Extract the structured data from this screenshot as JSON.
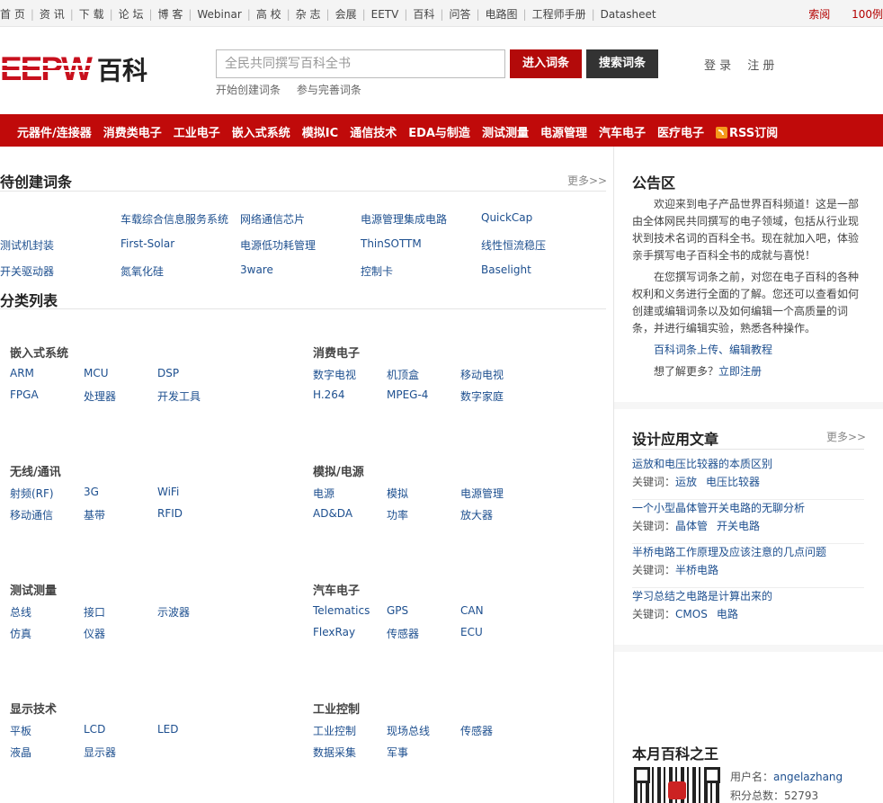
{
  "topnav": {
    "items": [
      "首 页",
      "资 讯",
      "下 载",
      "论 坛",
      "博 客",
      "Webinar",
      "高 校",
      "杂 志",
      "会展",
      "EETV",
      "百科",
      "问答",
      "电路图",
      "工程师手册",
      "Datasheet"
    ],
    "right": [
      "索阅",
      "100例"
    ]
  },
  "header": {
    "logo_text": "EEPW",
    "logo_suffix": "百科",
    "search_placeholder": "全民共同撰写百科全书",
    "enter_button": "进入词条",
    "search_button": "搜索词条",
    "sublinks": [
      "开始创建词条",
      "参与完善词条"
    ],
    "login": "登 录",
    "register": "注 册"
  },
  "categories": [
    "元器件/连接器",
    "消费类电子",
    "工业电子",
    "嵌入式系统",
    "模拟IC",
    "通信技术",
    "EDA与制造",
    "测试测量",
    "电源管理",
    "汽车电子",
    "医疗电子"
  ],
  "rss_label": "RSS订阅",
  "pending": {
    "title": "待创建词条",
    "more": "更多>>",
    "rows": [
      [
        "",
        "车载综合信息服务系统",
        "网络通信芯片",
        "电源管理集成电路",
        "QuickCap"
      ],
      [
        "测试机封装",
        "First-Solar",
        "电源低功耗管理",
        "ThinSOTTM",
        "线性恒流稳压"
      ],
      [
        "开关驱动器",
        "氮氧化硅",
        "3ware",
        "控制卡",
        "Baselight"
      ]
    ]
  },
  "classify": {
    "title": "分类列表",
    "groups": [
      {
        "title": "嵌入式系统",
        "rows": [
          [
            "ARM",
            "MCU",
            "DSP"
          ],
          [
            "FPGA",
            "处理器",
            "开发工具"
          ]
        ]
      },
      {
        "title": "消费电子",
        "rows": [
          [
            "数字电视",
            "机顶盒",
            "移动电视"
          ],
          [
            "H.264",
            "MPEG-4",
            "数字家庭"
          ]
        ]
      },
      {
        "title": "无线/通讯",
        "rows": [
          [
            "射频(RF)",
            "3G",
            "WiFi"
          ],
          [
            "移动通信",
            "基带",
            "RFID"
          ]
        ]
      },
      {
        "title": "模拟/电源",
        "rows": [
          [
            "电源",
            "模拟",
            "电源管理"
          ],
          [
            "AD&DA",
            "功率",
            "放大器"
          ]
        ]
      },
      {
        "title": "测试测量",
        "rows": [
          [
            "总线",
            "接口",
            "示波器"
          ],
          [
            "仿真",
            "仪器",
            ""
          ]
        ]
      },
      {
        "title": "汽车电子",
        "rows": [
          [
            "Telematics",
            "GPS",
            "CAN"
          ],
          [
            "FlexRay",
            "传感器",
            "ECU"
          ]
        ]
      },
      {
        "title": "显示技术",
        "rows": [
          [
            "平板",
            "LCD",
            "LED"
          ],
          [
            "液晶",
            "显示器",
            ""
          ]
        ]
      },
      {
        "title": "工业控制",
        "rows": [
          [
            "工业控制",
            "现场总线",
            "传感器"
          ],
          [
            "数据采集",
            "军事",
            ""
          ]
        ]
      }
    ]
  },
  "notice": {
    "title": "公告区",
    "para1": "欢迎来到电子产品世界百科频道！这是一部由全体网民共同撰写的电子领域，包括从行业现状到技术名词的百科全书。现在就加入吧，体验亲手撰写电子百科全书的成就与喜悦！",
    "para2": "在您撰写词条之前，对您在电子百科的各种权利和义务进行全面的了解。您还可以查看如何创建或编辑词条以及如何编辑一个高质量的词条，并进行编辑实验，熟悉各种操作。",
    "link1": "百科词条上传、编辑教程",
    "ask": "想了解更多？",
    "link2": "立即注册"
  },
  "articles": {
    "title": "设计应用文章",
    "more": "更多>>",
    "kw_label": "关键词：",
    "items": [
      {
        "title": "运放和电压比较器的本质区别",
        "keywords": [
          "运放",
          "电压比较器"
        ]
      },
      {
        "title": "一个小型晶体管开关电路的无聊分析",
        "keywords": [
          "晶体管",
          "开关电路"
        ]
      },
      {
        "title": "半桥电路工作原理及应该注意的几点问题",
        "keywords": [
          "半桥电路"
        ]
      },
      {
        "title": "学习总结之电路是计算出来的",
        "keywords": [
          "CMOS",
          "电路"
        ]
      }
    ]
  },
  "king": {
    "title": "本月百科之王",
    "user_label": "用户名：",
    "user": "angelazhang",
    "score_label": "积分总数：",
    "score": "52793"
  },
  "colors": {
    "brand_red": "#c00a0a",
    "link_blue": "#1d4f8f"
  }
}
